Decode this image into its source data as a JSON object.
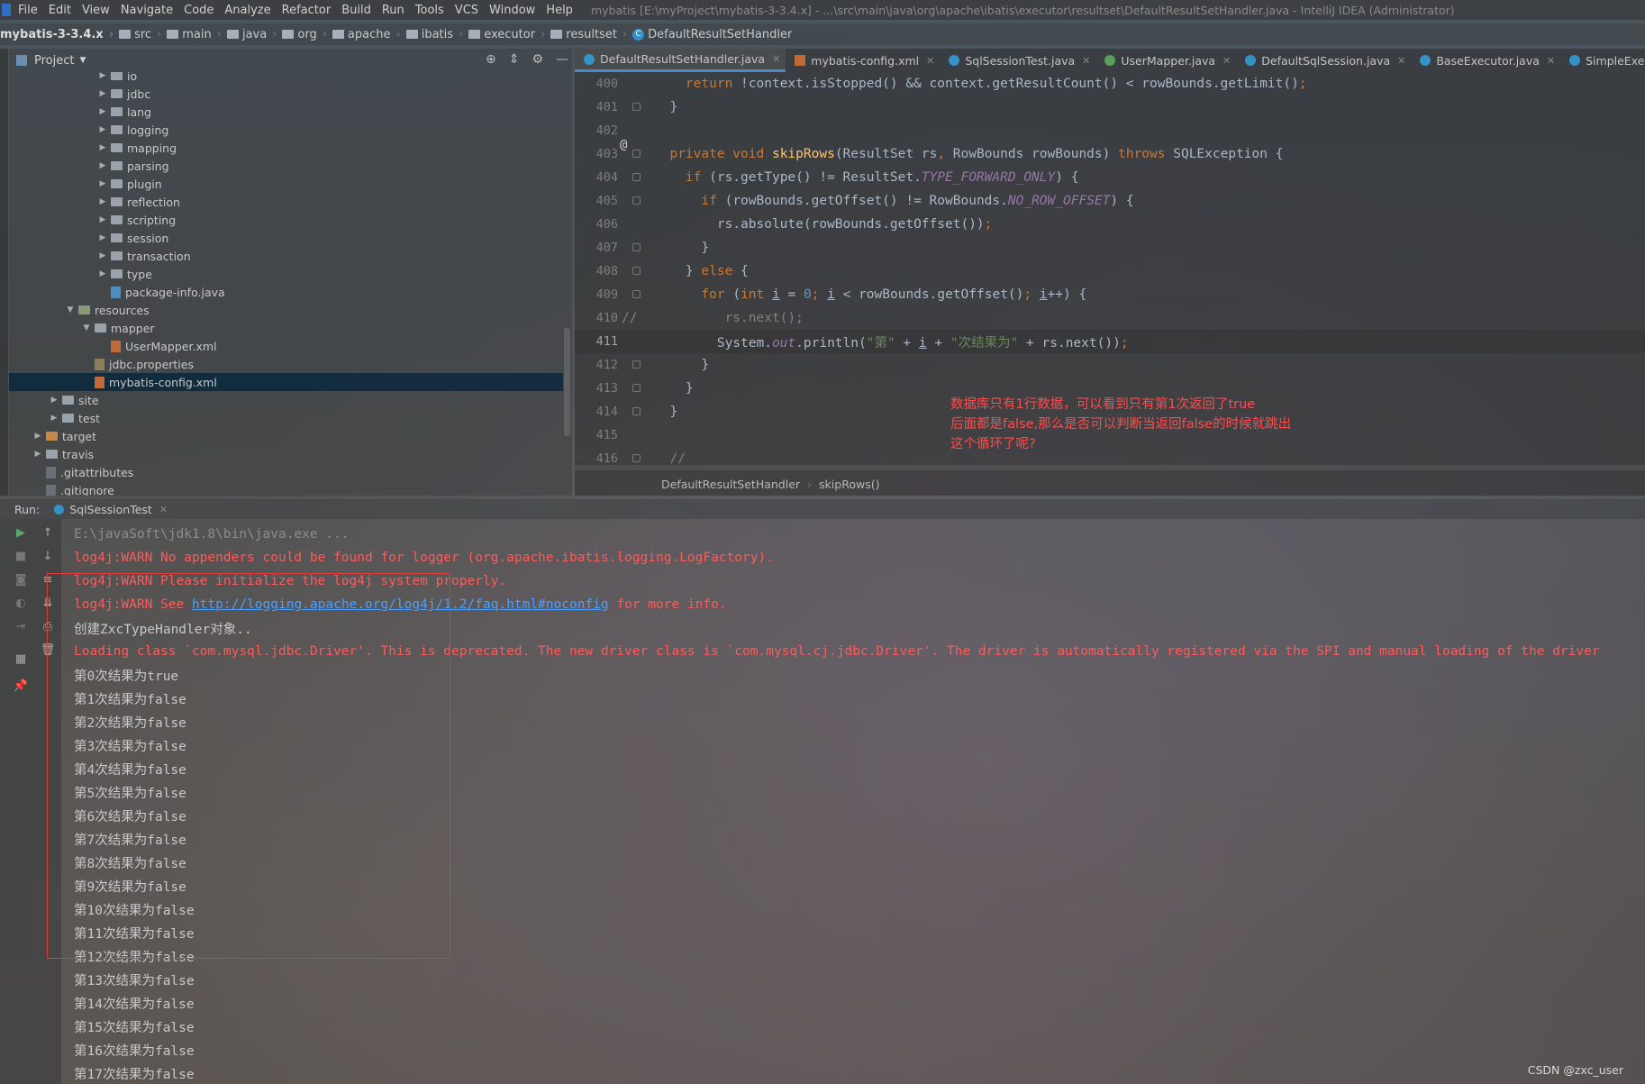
{
  "menu": {
    "items": [
      "File",
      "Edit",
      "View",
      "Navigate",
      "Code",
      "Analyze",
      "Refactor",
      "Build",
      "Run",
      "Tools",
      "VCS",
      "Window",
      "Help"
    ],
    "window_title": "mybatis [E:\\myProject\\mybatis-3-3.4.x] - ...\\src\\main\\java\\org\\apache\\ibatis\\executor\\resultset\\DefaultResultSetHandler.java - IntelliJ IDEA (Administrator)"
  },
  "nav": {
    "project": "mybatis-3-3.4.x",
    "crumbs": [
      "src",
      "main",
      "java",
      "org",
      "apache",
      "ibatis",
      "executor",
      "resultset"
    ],
    "class": "DefaultResultSetHandler"
  },
  "project_panel": {
    "title": "Project",
    "tree": [
      {
        "label": "io",
        "indent": 5,
        "kind": "folder",
        "open": false
      },
      {
        "label": "jdbc",
        "indent": 5,
        "kind": "folder",
        "open": false
      },
      {
        "label": "lang",
        "indent": 5,
        "kind": "folder",
        "open": false
      },
      {
        "label": "logging",
        "indent": 5,
        "kind": "folder",
        "open": false
      },
      {
        "label": "mapping",
        "indent": 5,
        "kind": "folder",
        "open": false
      },
      {
        "label": "parsing",
        "indent": 5,
        "kind": "folder",
        "open": false
      },
      {
        "label": "plugin",
        "indent": 5,
        "kind": "folder",
        "open": false
      },
      {
        "label": "reflection",
        "indent": 5,
        "kind": "folder",
        "open": false
      },
      {
        "label": "scripting",
        "indent": 5,
        "kind": "folder",
        "open": false
      },
      {
        "label": "session",
        "indent": 5,
        "kind": "folder",
        "open": false
      },
      {
        "label": "transaction",
        "indent": 5,
        "kind": "folder",
        "open": false
      },
      {
        "label": "type",
        "indent": 5,
        "kind": "folder",
        "open": false
      },
      {
        "label": "package-info.java",
        "indent": 5,
        "kind": "java",
        "open": null
      },
      {
        "label": "resources",
        "indent": 3,
        "kind": "res",
        "open": true
      },
      {
        "label": "mapper",
        "indent": 4,
        "kind": "folder",
        "open": true
      },
      {
        "label": "UserMapper.xml",
        "indent": 5,
        "kind": "xml",
        "open": null
      },
      {
        "label": "jdbc.properties",
        "indent": 4,
        "kind": "prop",
        "open": null
      },
      {
        "label": "mybatis-config.xml",
        "indent": 4,
        "kind": "xml",
        "open": null,
        "selected": true
      },
      {
        "label": "site",
        "indent": 2,
        "kind": "folder",
        "open": false
      },
      {
        "label": "test",
        "indent": 2,
        "kind": "folder",
        "open": false
      },
      {
        "label": "target",
        "indent": 1,
        "kind": "target",
        "open": false
      },
      {
        "label": "travis",
        "indent": 1,
        "kind": "folder",
        "open": false
      },
      {
        "label": ".gitattributes",
        "indent": 1,
        "kind": "git",
        "open": null
      },
      {
        "label": ".gitignore",
        "indent": 1,
        "kind": "git",
        "open": null
      }
    ]
  },
  "editor": {
    "tabs": [
      {
        "label": "DefaultResultSetHandler.java",
        "icon": "class",
        "active": true
      },
      {
        "label": "mybatis-config.xml",
        "icon": "xml",
        "active": false
      },
      {
        "label": "SqlSessionTest.java",
        "icon": "class",
        "active": false
      },
      {
        "label": "UserMapper.java",
        "icon": "iface",
        "active": false
      },
      {
        "label": "DefaultSqlSession.java",
        "icon": "class",
        "active": false
      },
      {
        "label": "BaseExecutor.java",
        "icon": "class",
        "active": false
      },
      {
        "label": "SimpleExecutor.java",
        "icon": "class",
        "active": false
      }
    ],
    "line_numbers": [
      "400",
      "401",
      "402",
      "403",
      "404",
      "405",
      "406",
      "407",
      "408",
      "409",
      "410",
      "411",
      "412",
      "413",
      "414",
      "415",
      "416"
    ],
    "annotation": [
      "数据库只有1行数据，可以看到只有第1次返回了true",
      "后面都是false,那么是否可以判断当返回false的时候就跳出",
      "这个循环了呢?"
    ],
    "breadcrumb": [
      "DefaultResultSetHandler",
      "skipRows()"
    ]
  },
  "run": {
    "label": "Run:",
    "tab": "SqlSessionTest",
    "lines": [
      {
        "t": "E:\\javaSoft\\jdk1.8\\bin\\java.exe ...",
        "c": "gray"
      },
      {
        "t": "log4j:WARN No appenders could be found for logger (org.apache.ibatis.logging.LogFactory).",
        "c": "red"
      },
      {
        "t": "log4j:WARN Please initialize the log4j system properly.",
        "c": "red"
      },
      {
        "t": "log4j:WARN See ",
        "c": "red",
        "link": "http://logging.apache.org/log4j/1.2/faq.html#noconfig",
        "after": " for more info."
      },
      {
        "t": "创建ZxcTypeHandler对象..",
        "c": "norm"
      },
      {
        "t": "Loading class `com.mysql.jdbc.Driver'. This is deprecated. The new driver class is `com.mysql.cj.jdbc.Driver'. The driver is automatically registered via the SPI and manual loading of the driver",
        "c": "red"
      },
      {
        "t": "第0次结果为true",
        "c": "norm"
      },
      {
        "t": "第1次结果为false",
        "c": "norm"
      },
      {
        "t": "第2次结果为false",
        "c": "norm"
      },
      {
        "t": "第3次结果为false",
        "c": "norm"
      },
      {
        "t": "第4次结果为false",
        "c": "norm"
      },
      {
        "t": "第5次结果为false",
        "c": "norm"
      },
      {
        "t": "第6次结果为false",
        "c": "norm"
      },
      {
        "t": "第7次结果为false",
        "c": "norm"
      },
      {
        "t": "第8次结果为false",
        "c": "norm"
      },
      {
        "t": "第9次结果为false",
        "c": "norm"
      },
      {
        "t": "第10次结果为false",
        "c": "norm"
      },
      {
        "t": "第11次结果为false",
        "c": "norm"
      },
      {
        "t": "第12次结果为false",
        "c": "norm"
      },
      {
        "t": "第13次结果为false",
        "c": "norm"
      },
      {
        "t": "第14次结果为false",
        "c": "norm"
      },
      {
        "t": "第15次结果为false",
        "c": "norm"
      },
      {
        "t": "第16次结果为false",
        "c": "norm"
      },
      {
        "t": "第17次结果为false",
        "c": "norm"
      }
    ]
  },
  "watermark": "CSDN @zxc_user",
  "colors": {
    "accent": "#4a88c7",
    "selection": "#0d293e",
    "annotation": "#ff4b4b",
    "warn": "#ff5a5a"
  }
}
